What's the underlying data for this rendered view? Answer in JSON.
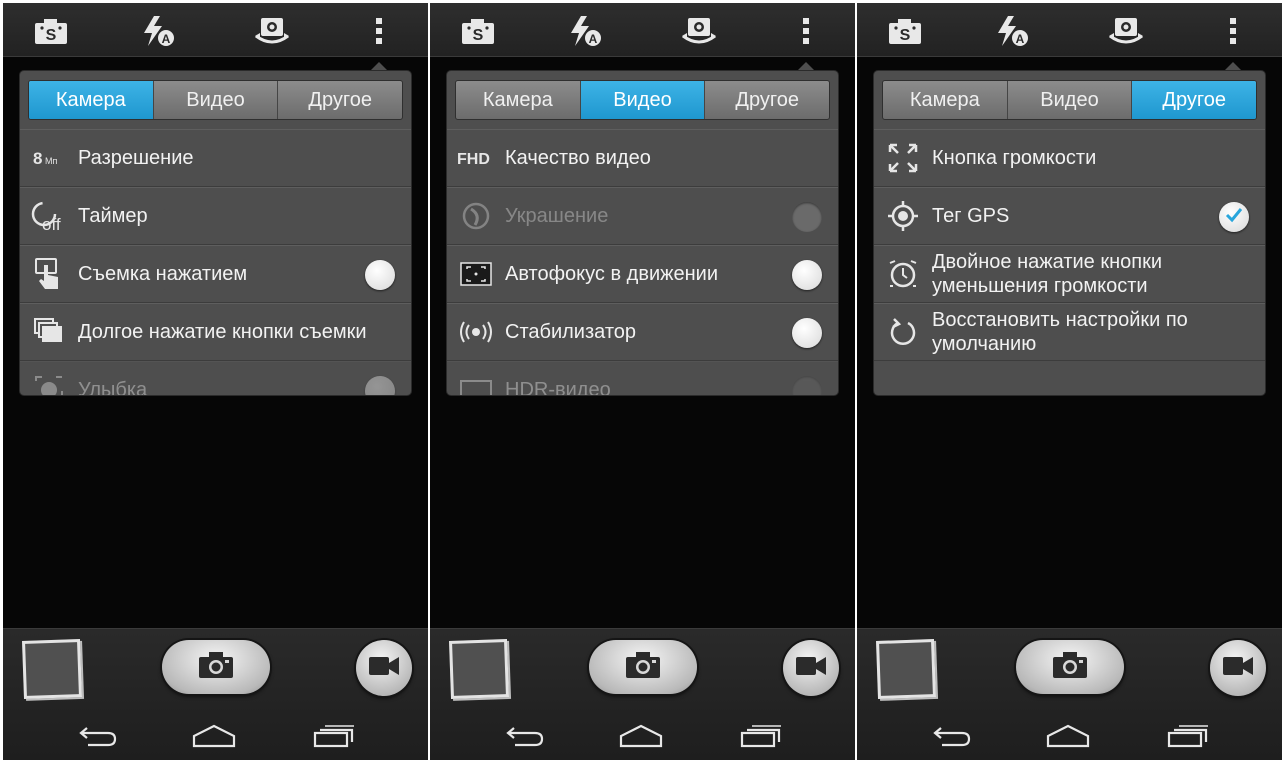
{
  "top_icons": [
    "scene-mode-s-icon",
    "flash-auto-icon",
    "camera-switch-icon",
    "overflow-menu-icon"
  ],
  "tabs": [
    "Камера",
    "Видео",
    "Другое"
  ],
  "colors": {
    "accent": "#29a6dc",
    "panel": "#4e4e4e",
    "background": "#060606"
  },
  "screens": [
    {
      "active_tab": 0,
      "rows": [
        {
          "icon": "resolution-8mp-icon",
          "icon_text": "8",
          "icon_sub": "Мп",
          "label": "Разрешение",
          "control": "none"
        },
        {
          "icon": "timer-off-icon",
          "icon_text": "off",
          "label": "Таймер",
          "control": "none"
        },
        {
          "icon": "touch-shot-icon",
          "label": "Съемка нажатием",
          "control": "toggle"
        },
        {
          "icon": "burst-shot-icon",
          "label": "Долгое нажатие кнопки съемки",
          "control": "none"
        },
        {
          "icon": "smile-icon",
          "label": "Улыбка",
          "control": "toggle",
          "partial": true
        }
      ]
    },
    {
      "active_tab": 1,
      "rows": [
        {
          "icon": "fhd-icon",
          "icon_text": "FHD",
          "label": "Качество видео",
          "control": "none"
        },
        {
          "icon": "beauty-icon",
          "label": "Украшение",
          "control": "toggle-disabled",
          "disabled": true
        },
        {
          "icon": "continuous-af-icon",
          "label": "Автофокус в движении",
          "control": "toggle"
        },
        {
          "icon": "stabilizer-icon",
          "label": "Стабилизатор",
          "control": "toggle"
        },
        {
          "icon": "hdr-video-icon",
          "label": "HDR-видео",
          "control": "toggle-disabled",
          "partial": true
        }
      ]
    },
    {
      "active_tab": 2,
      "rows": [
        {
          "icon": "volume-key-icon",
          "label": "Кнопка громкости",
          "control": "none"
        },
        {
          "icon": "gps-icon",
          "label": "Тег GPS",
          "control": "checked"
        },
        {
          "icon": "quick-launch-icon",
          "label": "Двойное нажатие кнопки уменьшения громкости",
          "control": "none"
        },
        {
          "icon": "reset-icon",
          "label": "Восстановить настройки по умолчанию",
          "control": "none"
        }
      ]
    }
  ],
  "bottom": {
    "thumbnail": "gallery-thumbnail",
    "shutter": "camera-shutter-icon",
    "video": "video-record-icon",
    "nav": [
      "back-icon",
      "home-icon",
      "recent-apps-icon"
    ]
  }
}
